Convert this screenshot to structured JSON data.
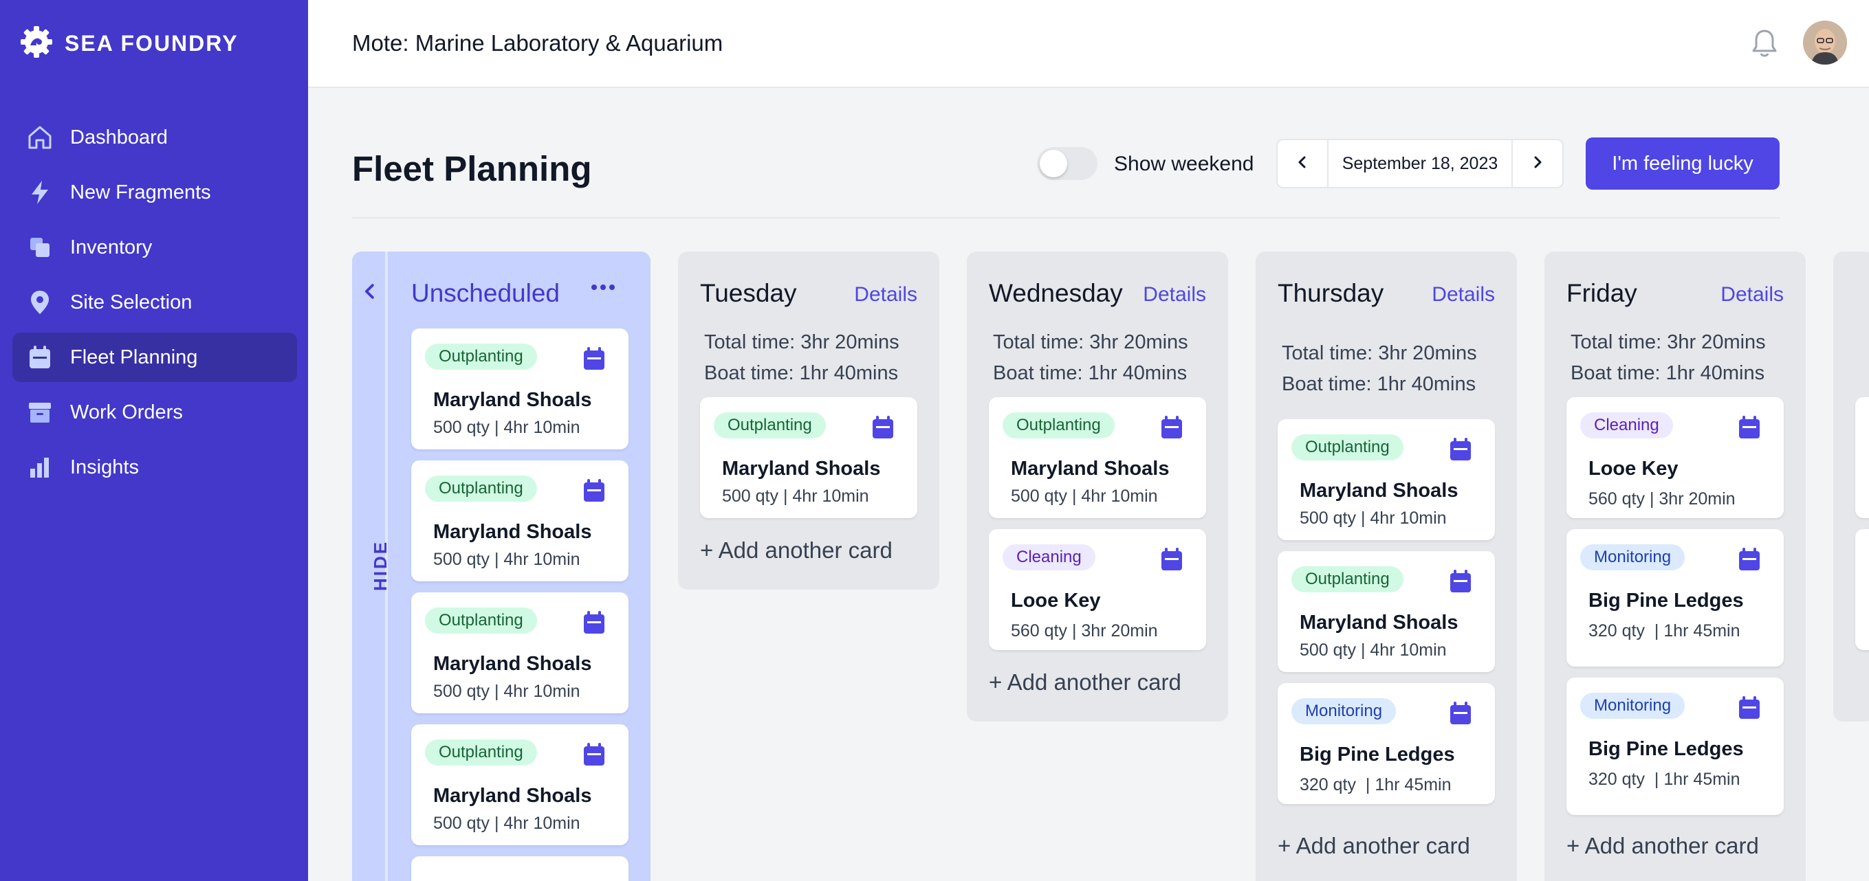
{
  "brand": {
    "name": "SEA FOUNDRY"
  },
  "sidebar": {
    "items": [
      {
        "label": "Dashboard",
        "icon": "home-icon"
      },
      {
        "label": "New Fragments",
        "icon": "bolt-icon"
      },
      {
        "label": "Inventory",
        "icon": "stack-icon"
      },
      {
        "label": "Site Selection",
        "icon": "map-pin-icon"
      },
      {
        "label": "Fleet Planning",
        "icon": "calendar-icon",
        "active": true
      },
      {
        "label": "Work Orders",
        "icon": "archive-icon"
      },
      {
        "label": "Insights",
        "icon": "bar-chart-icon"
      }
    ]
  },
  "header": {
    "org_title": "Mote: Marine Laboratory & Aquarium"
  },
  "page": {
    "title": "Fleet Planning",
    "show_weekend_label": "Show weekend",
    "show_weekend": false,
    "date": "September 18, 2023",
    "lucky_button": "I'm feeling lucky"
  },
  "board": {
    "hide_label": "HIDE",
    "unscheduled": {
      "title": "Unscheduled",
      "cards": [
        {
          "tag": "Outplanting",
          "title": "Maryland Shoals",
          "sub": "500 qty | 4hr 10min"
        },
        {
          "tag": "Outplanting",
          "title": "Maryland Shoals",
          "sub": "500 qty | 4hr 10min"
        },
        {
          "tag": "Outplanting",
          "title": "Maryland Shoals",
          "sub": "500 qty | 4hr 10min"
        },
        {
          "tag": "Outplanting",
          "title": "Maryland Shoals",
          "sub": "500 qty | 4hr 10min"
        }
      ]
    },
    "days": [
      {
        "name": "Tuesday",
        "details": "Details",
        "total_time": "Total time: 3hr 20mins",
        "boat_time": "Boat time: 1hr 40mins",
        "cards": [
          {
            "tag": "Outplanting",
            "title": "Maryland Shoals",
            "sub": "500 qty | 4hr 10min"
          }
        ],
        "add_card": "+ Add another card"
      },
      {
        "name": "Wednesday",
        "details": "Details",
        "total_time": "Total time: 3hr 20mins",
        "boat_time": "Boat time: 1hr 40mins",
        "cards": [
          {
            "tag": "Outplanting",
            "title": "Maryland Shoals",
            "sub": "500 qty | 4hr 10min"
          },
          {
            "tag": "Cleaning",
            "title": "Looe Key",
            "sub": "560 qty | 3hr 20min"
          }
        ],
        "add_card": "+ Add another card"
      },
      {
        "name": "Thursday",
        "details": "Details",
        "total_time": "Total time: 3hr 20mins",
        "boat_time": "Boat time: 1hr 40mins",
        "cards": [
          {
            "tag": "Outplanting",
            "title": "Maryland Shoals",
            "sub": "500 qty | 4hr 10min"
          },
          {
            "tag": "Outplanting",
            "title": "Maryland Shoals",
            "sub": "500 qty | 4hr 10min"
          },
          {
            "tag": "Monitoring",
            "title": "Big Pine Ledges",
            "sub": "320 qty  | 1hr 45min"
          }
        ],
        "add_card": "+ Add another card"
      },
      {
        "name": "Friday",
        "details": "Details",
        "total_time": "Total time: 3hr 20mins",
        "boat_time": "Boat time: 1hr 40mins",
        "cards": [
          {
            "tag": "Cleaning",
            "title": "Looe Key",
            "sub": "560 qty | 3hr 20min"
          },
          {
            "tag": "Monitoring",
            "title": "Big Pine Ledges",
            "sub": "320 qty  | 1hr 45min"
          },
          {
            "tag": "Monitoring",
            "title": "Big Pine Ledges",
            "sub": "320 qty  | 1hr 45min"
          }
        ],
        "add_card": "+ Add another card"
      }
    ]
  },
  "colors": {
    "sidebar": "#4338ca",
    "accent": "#4f46e5",
    "unscheduled_bg": "#c7d2fe"
  }
}
